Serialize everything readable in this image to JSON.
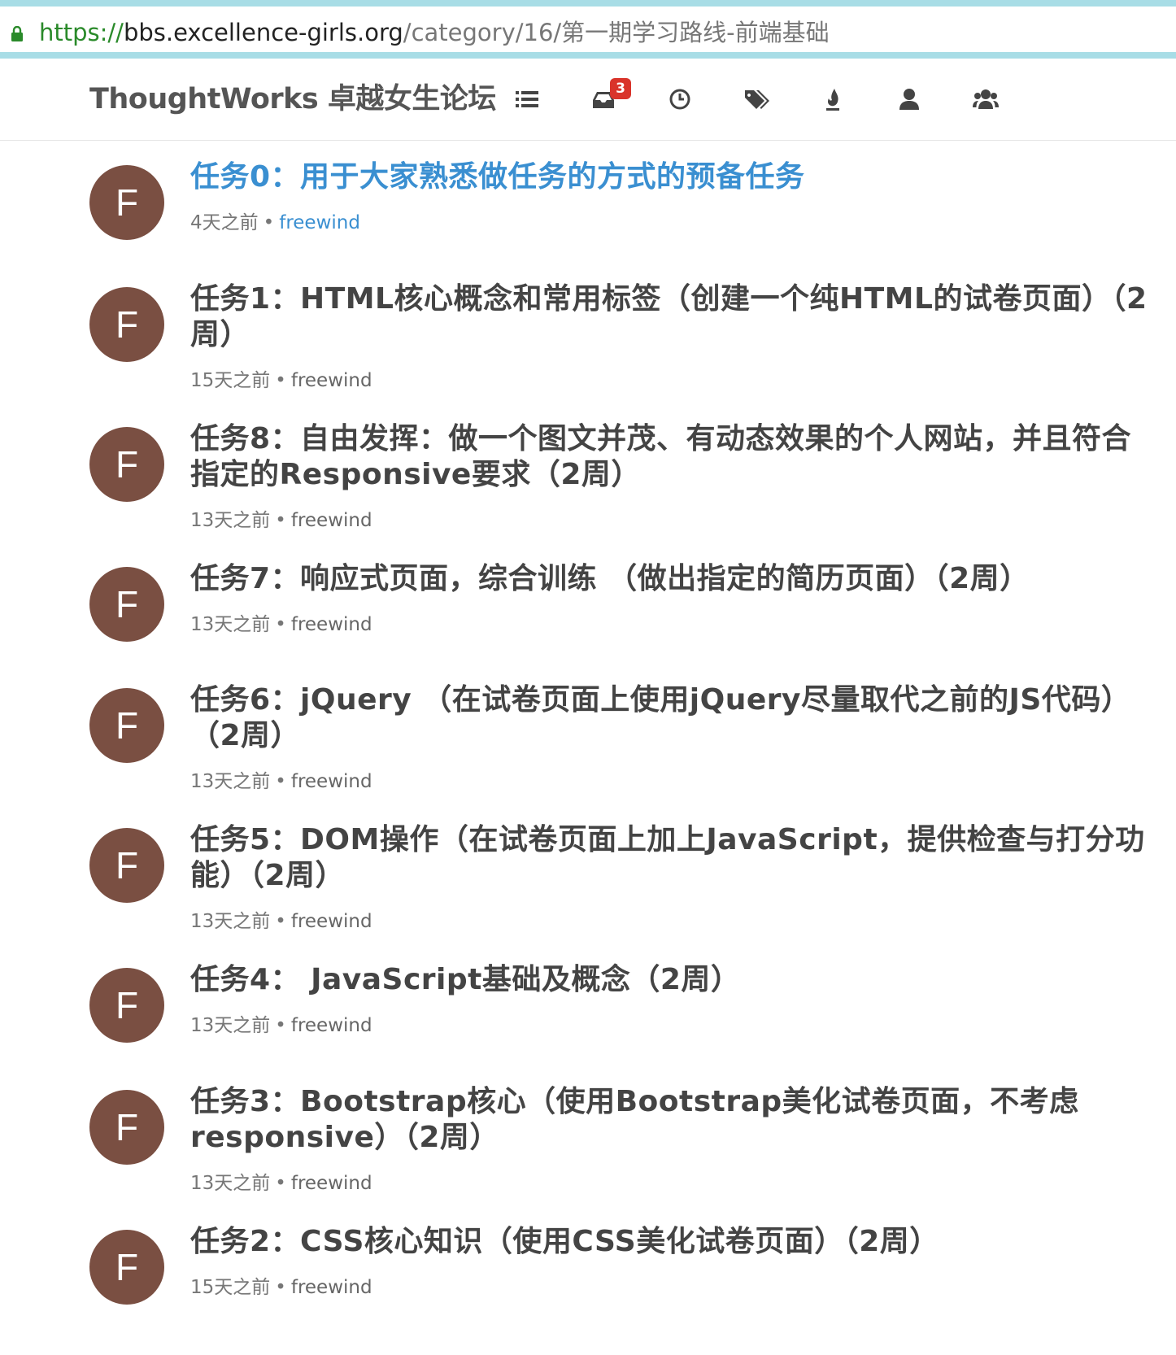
{
  "browser": {
    "url_scheme": "https://",
    "url_host": "bbs.excellence-girls.org",
    "url_path": "/category/16/第一期学习路线-前端基础"
  },
  "navbar": {
    "brand": "ThoughtWorks 卓越女生论坛",
    "icons": [
      "list-icon",
      "inbox-icon",
      "clock-icon",
      "tags-icon",
      "fire-icon",
      "user-icon",
      "users-icon"
    ],
    "inbox_badge": "3"
  },
  "topics": [
    {
      "avatar": "F",
      "title": "任务0：用于大家熟悉做任务的方式的预备任务",
      "time": "4天之前",
      "sep": "•",
      "author": "freewind"
    },
    {
      "avatar": "F",
      "title": "任务1：HTML核心概念和常用标签（创建一个纯HTML的试卷页面）（2周）",
      "time": "15天之前",
      "sep": "•",
      "author": "freewind"
    },
    {
      "avatar": "F",
      "title": "任务8：自由发挥：做一个图文并茂、有动态效果的个人网站，并且符合指定的Responsive要求（2周）",
      "time": "13天之前",
      "sep": "•",
      "author": "freewind"
    },
    {
      "avatar": "F",
      "title": "任务7：响应式页面，综合训练 （做出指定的简历页面）（2周）",
      "time": "13天之前",
      "sep": "•",
      "author": "freewind"
    },
    {
      "avatar": "F",
      "title": "任务6：jQuery （在试卷页面上使用jQuery尽量取代之前的JS代码）（2周）",
      "time": "13天之前",
      "sep": "•",
      "author": "freewind"
    },
    {
      "avatar": "F",
      "title": "任务5：DOM操作（在试卷页面上加上JavaScript，提供检查与打分功能）（2周）",
      "time": "13天之前",
      "sep": "•",
      "author": "freewind"
    },
    {
      "avatar": "F",
      "title": "任务4： JavaScript基础及概念（2周）",
      "time": "13天之前",
      "sep": "•",
      "author": "freewind"
    },
    {
      "avatar": "F",
      "title": "任务3：Bootstrap核心（使用Bootstrap美化试卷页面，不考虑responsive）（2周）",
      "time": "13天之前",
      "sep": "•",
      "author": "freewind"
    },
    {
      "avatar": "F",
      "title": "任务2：CSS核心知识（使用CSS美化试卷页面）（2周）",
      "time": "15天之前",
      "sep": "•",
      "author": "freewind"
    }
  ]
}
